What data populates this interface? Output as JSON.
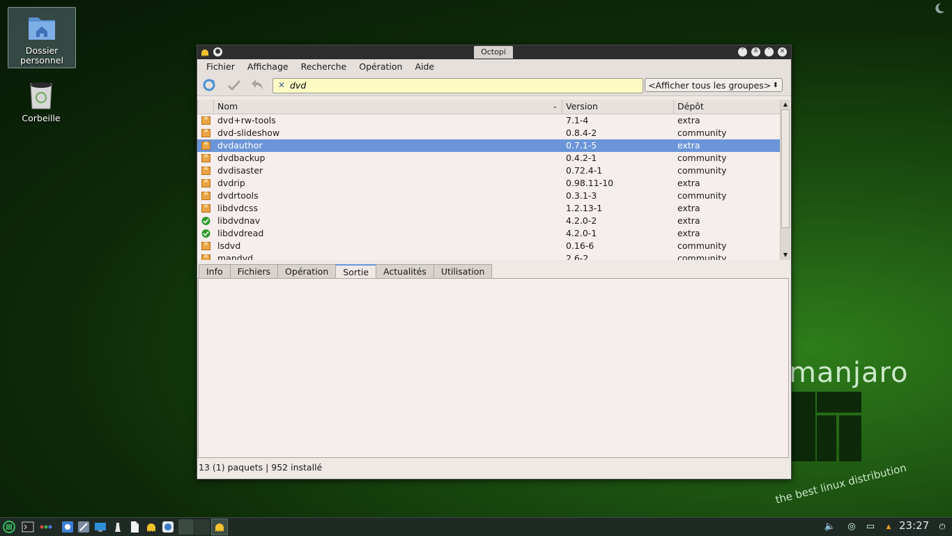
{
  "desktop": {
    "icons": [
      {
        "label": "Dossier personnel"
      },
      {
        "label": "Corbeille"
      }
    ],
    "wallpaper_text": "manjaro",
    "wallpaper_tagline": "the best linux distribution"
  },
  "window": {
    "title": "Octopi",
    "menu": [
      "Fichier",
      "Affichage",
      "Recherche",
      "Opération",
      "Aide"
    ],
    "search": {
      "value": "dvd"
    },
    "group_select": "<Afficher tous les groupes>",
    "columns": {
      "name": "Nom",
      "version": "Version",
      "repo": "Dépôt"
    },
    "packages": [
      {
        "name": "dvd+rw-tools",
        "version": "7.1-4",
        "repo": "extra",
        "installed": false
      },
      {
        "name": "dvd-slideshow",
        "version": "0.8.4-2",
        "repo": "community",
        "installed": false
      },
      {
        "name": "dvdauthor",
        "version": "0.7.1-5",
        "repo": "extra",
        "installed": false,
        "selected": true
      },
      {
        "name": "dvdbackup",
        "version": "0.4.2-1",
        "repo": "community",
        "installed": false
      },
      {
        "name": "dvdisaster",
        "version": "0.72.4-1",
        "repo": "community",
        "installed": false
      },
      {
        "name": "dvdrip",
        "version": "0.98.11-10",
        "repo": "extra",
        "installed": false
      },
      {
        "name": "dvdrtools",
        "version": "0.3.1-3",
        "repo": "community",
        "installed": false
      },
      {
        "name": "libdvdcss",
        "version": "1.2.13-1",
        "repo": "extra",
        "installed": false
      },
      {
        "name": "libdvdnav",
        "version": "4.2.0-2",
        "repo": "extra",
        "installed": true
      },
      {
        "name": "libdvdread",
        "version": "4.2.0-1",
        "repo": "extra",
        "installed": true
      },
      {
        "name": "lsdvd",
        "version": "0.16-6",
        "repo": "community",
        "installed": false
      },
      {
        "name": "mandvd",
        "version": "2.6-2",
        "repo": "community",
        "installed": false
      }
    ],
    "tabs": [
      "Info",
      "Fichiers",
      "Opération",
      "Sortie",
      "Actualités",
      "Utilisation"
    ],
    "active_tab": "Sortie",
    "status": "13 (1) paquets  | 952 installé"
  },
  "taskbar": {
    "clock": "23:27"
  },
  "colors": {
    "selection": "#6a95d8",
    "search_bg": "#fdfbc3",
    "desktop_green": "#1b4d10"
  }
}
